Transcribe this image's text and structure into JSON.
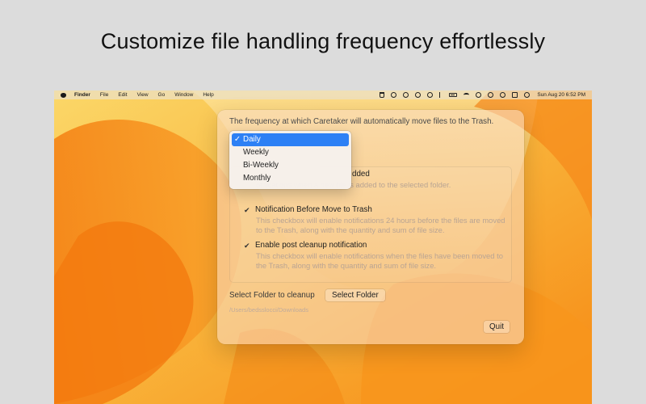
{
  "headline": "Customize file handling frequency effortlessly",
  "menubar": {
    "app_name": "Finder",
    "menus": [
      "File",
      "Edit",
      "View",
      "Go",
      "Window",
      "Help"
    ],
    "clock": "Sun Aug 20  6:52 PM"
  },
  "dialog": {
    "description": "The frequency at which Caretaker will automatically move files to the Trash.",
    "frequency_menu": {
      "options": [
        "Daily",
        "Weekly",
        "Bi-Weekly",
        "Monthly"
      ],
      "selected": "Daily",
      "check_mark": "✓"
    },
    "options": [
      {
        "label": "dded",
        "checked": true,
        "description": "otifications when a new file is added to the selected folder."
      },
      {
        "label": "Notification Before Move to Trash",
        "checked": true,
        "description": "This checkbox will enable notifications 24 hours before the files are moved to the Trash, along with the quantity and sum of file size."
      },
      {
        "label": "Enable post cleanup notification",
        "checked": true,
        "description": "This checkbox will enable notifications when the files have been moved to the Trash, along with the quantity and sum of file size."
      }
    ],
    "folder_label": "Select Folder to cleanup",
    "select_folder_button": "Select Folder",
    "folder_path": "/Users/bedsslocci/Downloads",
    "quit_button": "Quit",
    "check_glyph": "✔"
  },
  "icons": [
    "apple-icon",
    "trash-icon",
    "play-icon",
    "face-icon",
    "airdrop-icon",
    "headphones-icon",
    "bluetooth-icon",
    "battery-icon",
    "wifi-icon",
    "user-icon",
    "clock-icon",
    "search-icon",
    "control-center-icon",
    "siri-icon"
  ],
  "colors": {
    "selection_blue": "#2d80f5",
    "wallpaper_orange": "#f7a21f",
    "wallpaper_yellow": "#fbd25a"
  }
}
